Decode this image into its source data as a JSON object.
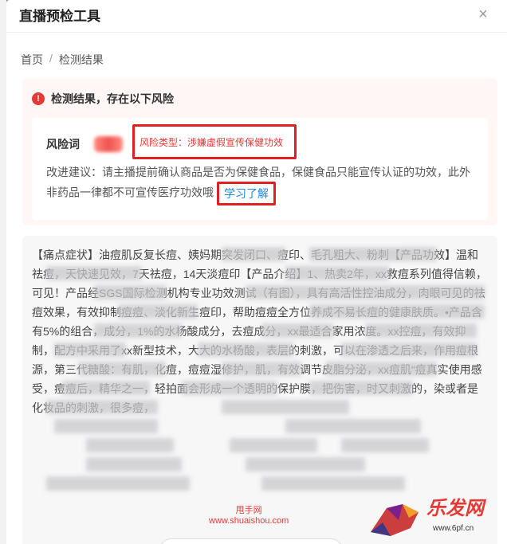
{
  "dialog": {
    "title": "直播预检工具",
    "close": "×"
  },
  "breadcrumb": {
    "home": "首页",
    "sep": "/",
    "current": "检测结果"
  },
  "risk": {
    "title": "检测结果，存在以下风险",
    "word_label": "风险词",
    "type_text": "风险类型：涉嫌虚假宣传保健功效",
    "suggestion": "改进建议：请主播提前确认商品是否为保健食品，保健食品只能宣传认证的功效，此外非药品一律都不可宣传医疗功效哦",
    "learn_more": "学习了解"
  },
  "content": {
    "text": "【痛点症状】油痘肌反复长痘、姨妈期突发闭口、痘印、毛孔粗大、粉刺【产品功效】温和祛痘，天快速见效，7天祛痘，14天淡痘印【产品介绍】1、热卖2年，xx救痘系列值得信赖，可见！产品经SGS国际检测机构专业功效测试（有图），具有高活性控油成分，肉眼可见的祛痘效果，有效抑制痘痘、淡化新生痘印，帮助痘痘全方位养成不易长痘的健康肤质。•产品含有5%的组合，成分，1%的水杨酸成分，去痘成分，xx最适合家用浓度。xx控痘，有效抑制，配方中采用了xx新型技术，大大的水杨酸，表层的刺激，可以在渗透之后来，作用痘根源，第三代糖酸：有肌，化痘，痘痘湿修护，肌，有效调节皮脂分泌，xx痘肌“痘真实使用感受，痘痘后，精华之一，轻拍面会形成一个透明的保护膜，把伤害，时又刺激的，染或者是化妆品的刺激，很多痘，"
  },
  "watermark": {
    "site": "甩手网",
    "url": "www.shuaishou.com"
  },
  "logo": {
    "text": "乐发网",
    "url": "www.6pf.cn"
  }
}
